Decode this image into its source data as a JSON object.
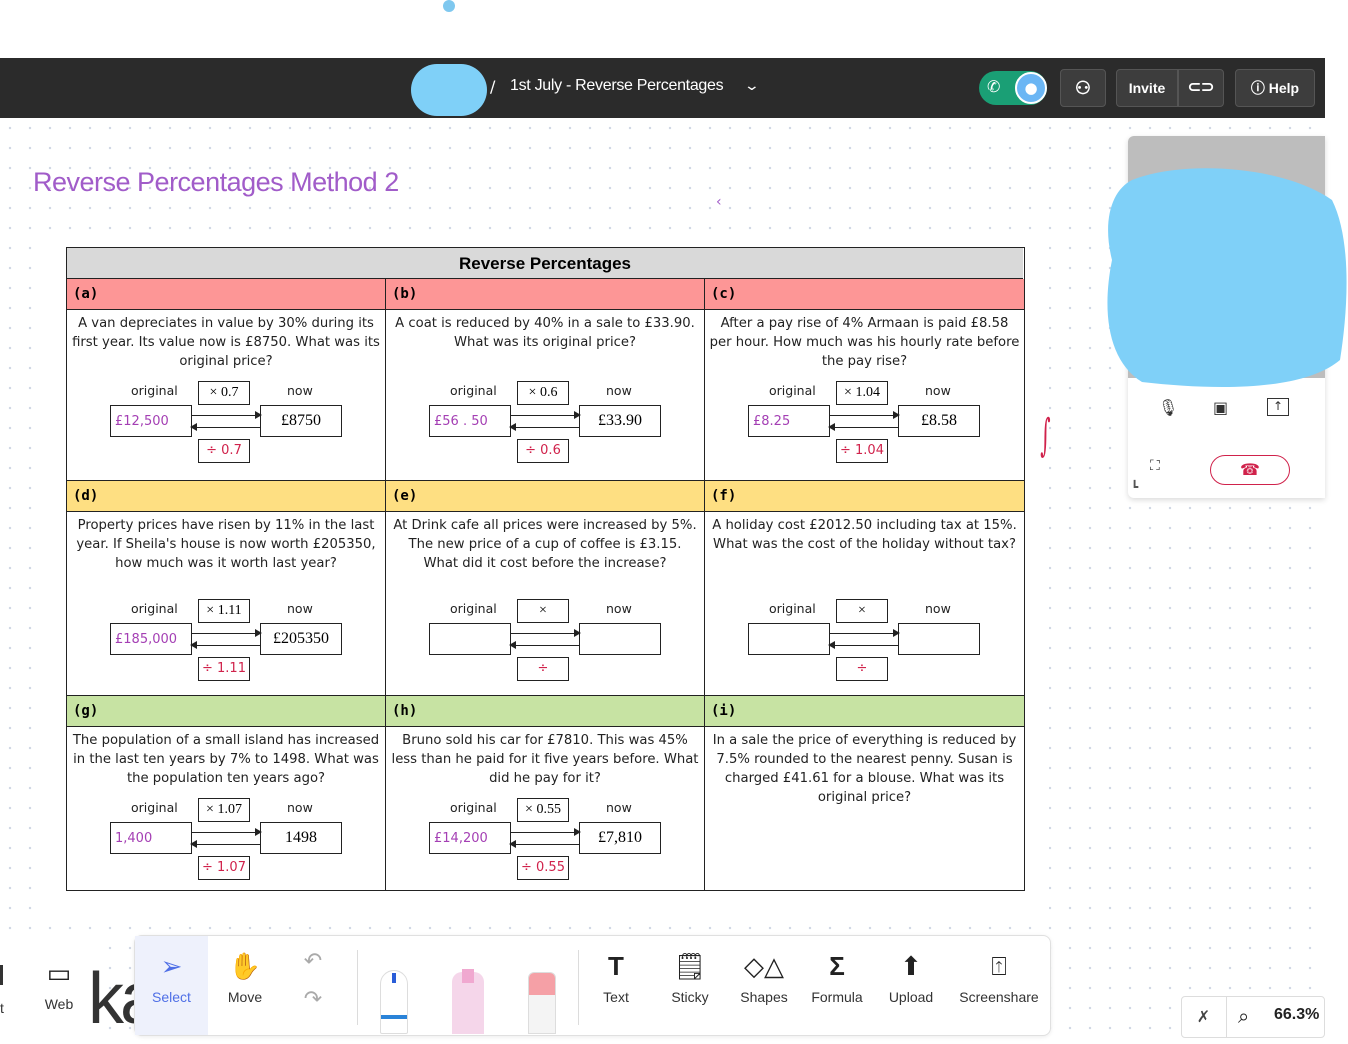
{
  "header": {
    "title_separator": "/",
    "board_title": "1st July - Reverse Percentages",
    "invite_label": "Invite",
    "help_label": "Help"
  },
  "board": {
    "heading": "Reverse Percentages Method 2",
    "caret_mark": "‹",
    "red_mark": "∫",
    "worksheet": {
      "title": "Reverse Percentages",
      "label_original": "original",
      "label_now": "now",
      "cells": [
        {
          "id": "(a)",
          "question": "A van depreciates in value by 30% during its first year. Its value now is £8750. What was its original price?",
          "mult": "× 0.7",
          "now": "£8750",
          "original_hw": "£12,500",
          "div_hw": "÷ 0.7"
        },
        {
          "id": "(b)",
          "question": "A coat is reduced by 40% in a sale to £33.90. What was its original price?",
          "mult": "× 0.6",
          "now": "£33.90",
          "original_hw": "£56 . 50",
          "div_hw": "÷ 0.6"
        },
        {
          "id": "(c)",
          "question": "After a pay rise of 4% Armaan is paid £8.58 per hour. How much was his hourly rate before the pay rise?",
          "mult": "× 1.04",
          "now": "£8.58",
          "original_hw": "£8.25",
          "div_hw": "÷ 1.04"
        },
        {
          "id": "(d)",
          "question": "Property prices have risen by 11% in the last year. If Sheila's house is now worth £205350, how much was it worth last year?",
          "mult": "× 1.11",
          "now": "£205350",
          "original_hw": "£185,000",
          "div_hw": "÷ 1.11"
        },
        {
          "id": "(e)",
          "question": "At Drink cafe all prices were increased by 5%. The new price of a cup of coffee is £3.15. What did it cost before the increase?",
          "mult": "×",
          "now": "",
          "original_hw": "",
          "div_hw": "÷"
        },
        {
          "id": "(f)",
          "question": "A holiday cost £2012.50 including tax at 15%. What was the cost of the holiday without tax?",
          "mult": "×",
          "now": "",
          "original_hw": "",
          "div_hw": "÷"
        },
        {
          "id": "(g)",
          "question": "The population of a small island has increased in the last ten years by 7% to 1498. What was the population ten years ago?",
          "mult": "× 1.07",
          "now": "1498",
          "original_hw": "1,400",
          "div_hw": "÷ 1.07"
        },
        {
          "id": "(h)",
          "question": "Bruno sold his car for £7810. This was 45% less than he paid for it five years before. What did he pay for it?",
          "mult": "× 0.55",
          "now": "£7,810",
          "original_hw": "£14,200",
          "div_hw": "÷ 0.55"
        },
        {
          "id": "(i)",
          "question": "In a sale the price of everything is reduced by 7.5% rounded to the nearest penny. Susan is charged £41.61 for a blouse. What was its original price?",
          "mult": "",
          "now": "",
          "original_hw": "",
          "div_hw": ""
        }
      ]
    }
  },
  "video": {
    "mic_icon": "🎙",
    "cam_icon": "■",
    "share_icon": "↑",
    "expand_icon": "⛶",
    "end_icon": "☎"
  },
  "toolbar": {
    "partial_left": "t",
    "web": "Web",
    "select": "Select",
    "move": "Move",
    "text": "Text",
    "sticky": "Sticky",
    "shapes": "Shapes",
    "formula": "Formula",
    "upload": "Upload",
    "screenshare": "Screenshare",
    "ka_text": "ka"
  },
  "zoom": {
    "level": "66.3%"
  },
  "colors": {
    "accent": "#4f6fe6",
    "heading": "#a15cc9",
    "call_green": "#1a9f75",
    "redaction": "#7fd0f8"
  }
}
